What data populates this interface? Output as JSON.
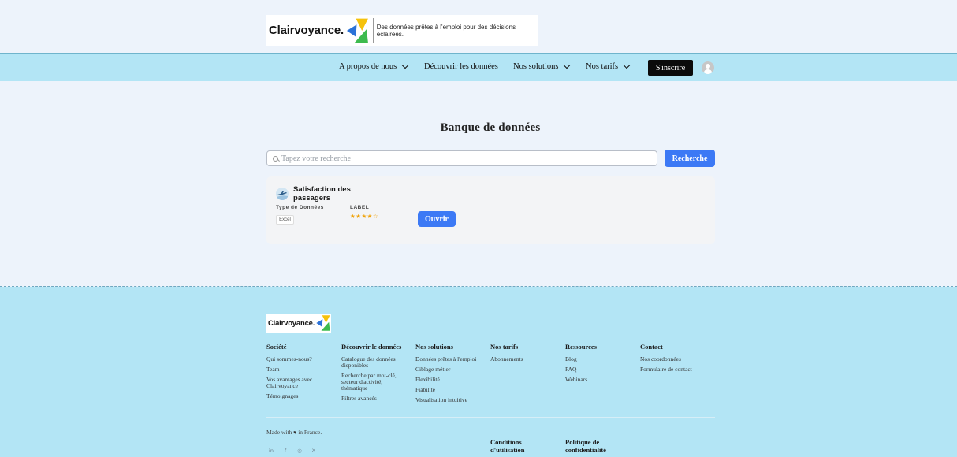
{
  "header": {
    "logo_text": "Clairvoyance.",
    "tagline": "Des données prêtes à l'emploi pour des décisions éclairées."
  },
  "nav": {
    "items": [
      {
        "label": "A propos de nous",
        "has_dropdown": true
      },
      {
        "label": "Découvrir les données",
        "has_dropdown": false
      },
      {
        "label": "Nos solutions",
        "has_dropdown": true
      },
      {
        "label": "Nos tarifs",
        "has_dropdown": true
      }
    ],
    "signup_label": "S'inscrire",
    "avatar_icon": "user-avatar-icon"
  },
  "main": {
    "title": "Banque de données",
    "search": {
      "placeholder": "Tapez votre recherche",
      "value": "",
      "button_label": "Recherche"
    },
    "dataset": {
      "title": "Satisfaction des passagers",
      "type_label": "Type de Données",
      "type_value": "Excel",
      "label_header": "LABEL",
      "rating": 4,
      "rating_max": 5,
      "stars": "★★★★☆",
      "open_label": "Ouvrir"
    }
  },
  "footer": {
    "logo_text": "Clairvoyance.",
    "columns": [
      {
        "heading": "Société",
        "items": [
          "Qui sommes-nous?",
          "Team",
          "Vos avantages avec Clairvoyance",
          "Témoignages"
        ]
      },
      {
        "heading": "Découvrir le données",
        "items": [
          "Catalogue des données disponibles",
          "Recherche par mot-clé, secteur d'activité, thématique",
          "Filtres avancés"
        ]
      },
      {
        "heading": "Nos solutions",
        "items": [
          "Données prêtes à l'emploi",
          "Ciblage métier",
          "Flexibilité",
          "Fiabilité",
          "Visualisation intuitive"
        ]
      },
      {
        "heading": "Nos tarifs",
        "items": [
          "Abonnements"
        ]
      },
      {
        "heading": "Ressources",
        "items": [
          "Blog",
          "FAQ",
          "Webinars"
        ]
      },
      {
        "heading": "Contact",
        "items": [
          "Nos coordonnées",
          "Formulaire de contact"
        ]
      }
    ],
    "made_with_prefix": "Made with",
    "made_with_suffix": "in France.",
    "legal": {
      "terms": "Conditions d'utilisation",
      "privacy": "Politique de confidentialité"
    },
    "social_icons": [
      "linkedin-icon",
      "facebook-icon",
      "instagram-icon",
      "x-icon"
    ],
    "social_glyphs": [
      "in",
      "f",
      "◎",
      "X"
    ]
  },
  "colors": {
    "accent": "#3c79f5",
    "nav_bg": "#b3e5f5",
    "page_bg": "#edf3fb",
    "signup_bg": "#0b0b0b",
    "star": "#f0a30a"
  }
}
